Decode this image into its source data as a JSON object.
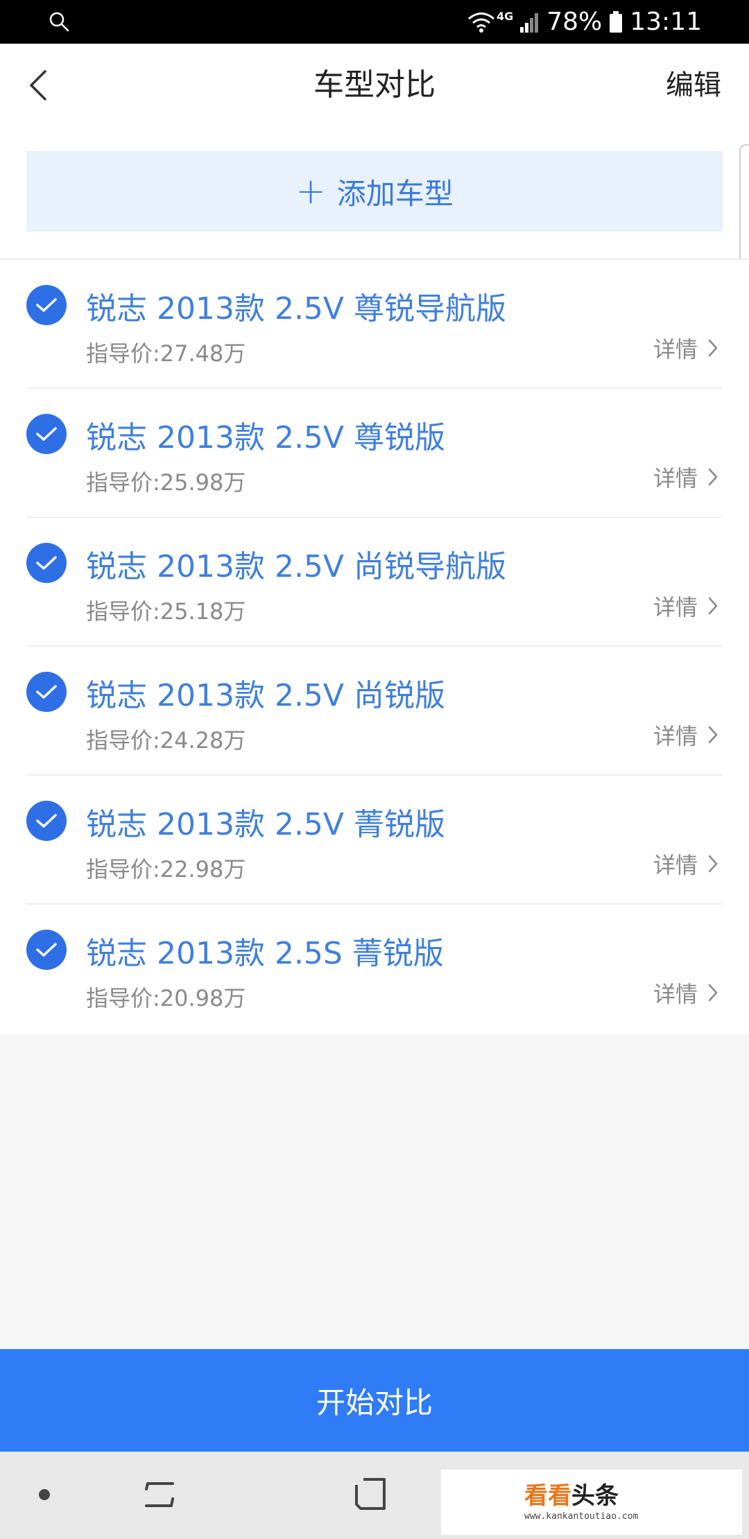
{
  "status_bar": {
    "network": "4G",
    "battery": "78%",
    "time": "13:11"
  },
  "header": {
    "title": "车型对比",
    "edit_label": "编辑"
  },
  "add_button": {
    "icon": "plus-icon",
    "label": "添加车型"
  },
  "cars": [
    {
      "name": "锐志 2013款 2.5V 尊锐导航版",
      "price": "指导价:27.48万",
      "detail": "详情",
      "checked": true
    },
    {
      "name": "锐志 2013款 2.5V 尊锐版",
      "price": "指导价:25.98万",
      "detail": "详情",
      "checked": true
    },
    {
      "name": "锐志 2013款 2.5V 尚锐导航版",
      "price": "指导价:25.18万",
      "detail": "详情",
      "checked": true
    },
    {
      "name": "锐志 2013款 2.5V 尚锐版",
      "price": "指导价:24.28万",
      "detail": "详情",
      "checked": true
    },
    {
      "name": "锐志 2013款 2.5V 菁锐版",
      "price": "指导价:22.98万",
      "detail": "详情",
      "checked": true
    },
    {
      "name": "锐志 2013款 2.5S 菁锐版",
      "price": "指导价:20.98万",
      "detail": "详情",
      "checked": true
    }
  ],
  "start_button": {
    "label": "开始对比"
  },
  "watermark": {
    "brand": "看看",
    "rest": "头条",
    "url": "www.kankantoutiao.com"
  },
  "colors": {
    "accent": "#2f7cf6",
    "check": "#2f6fe6",
    "car_name": "#3f7fdc",
    "add_bg": "#e9f1fd"
  }
}
